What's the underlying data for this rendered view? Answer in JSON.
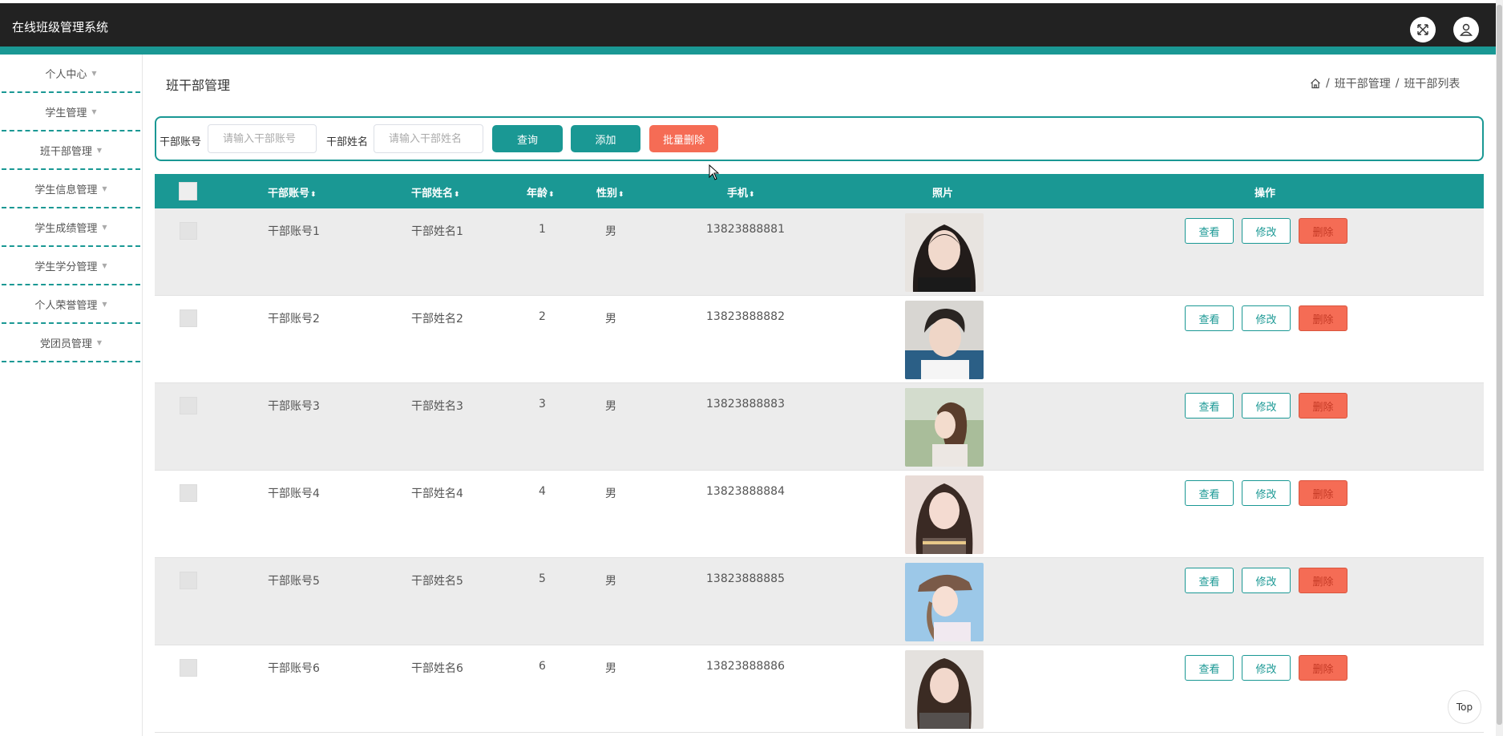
{
  "app": {
    "title": "在线班级管理系统"
  },
  "header": {
    "icons": [
      "fullscreen-icon",
      "user-icon"
    ]
  },
  "sidebar": {
    "items": [
      {
        "label": "个人中心"
      },
      {
        "label": "学生管理"
      },
      {
        "label": "班干部管理"
      },
      {
        "label": "学生信息管理"
      },
      {
        "label": "学生成绩管理"
      },
      {
        "label": "学生学分管理"
      },
      {
        "label": "个人荣誉管理"
      },
      {
        "label": "党团员管理"
      }
    ]
  },
  "page": {
    "title": "班干部管理",
    "breadcrumb": {
      "separator": "/",
      "items": [
        "班干部管理",
        "班干部列表"
      ]
    }
  },
  "search": {
    "account_label": "干部账号",
    "account_placeholder": "请输入干部账号",
    "name_label": "干部姓名",
    "name_placeholder": "请输入干部姓名",
    "query_label": "查询",
    "add_label": "添加",
    "batch_delete_label": "批量删除"
  },
  "table": {
    "columns": [
      "干部账号",
      "干部姓名",
      "年龄",
      "性别",
      "手机",
      "照片",
      "操作"
    ],
    "sort_icon": "⬍",
    "rows": [
      {
        "account": "干部账号1",
        "name": "干部姓名1",
        "age": "1",
        "gender": "男",
        "phone": "13823888881"
      },
      {
        "account": "干部账号2",
        "name": "干部姓名2",
        "age": "2",
        "gender": "男",
        "phone": "13823888882"
      },
      {
        "account": "干部账号3",
        "name": "干部姓名3",
        "age": "3",
        "gender": "男",
        "phone": "13823888883"
      },
      {
        "account": "干部账号4",
        "name": "干部姓名4",
        "age": "4",
        "gender": "男",
        "phone": "13823888884"
      },
      {
        "account": "干部账号5",
        "name": "干部姓名5",
        "age": "5",
        "gender": "男",
        "phone": "13823888885"
      },
      {
        "account": "干部账号6",
        "name": "干部姓名6",
        "age": "6",
        "gender": "男",
        "phone": "13823888886"
      }
    ],
    "actions": {
      "view": "查看",
      "edit": "修改",
      "delete": "删除"
    }
  },
  "scroll_top": "Top",
  "colors": {
    "accent": "#1a9894",
    "danger": "#f56c55",
    "topbar": "#222222"
  }
}
